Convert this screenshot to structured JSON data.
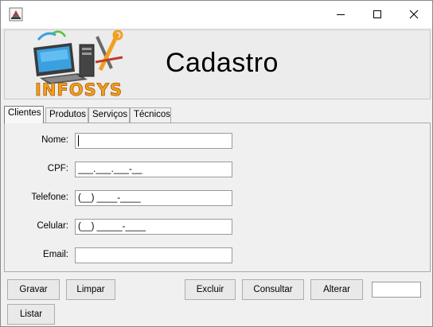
{
  "window": {
    "title": "",
    "icon": "java-app-icon",
    "controls": {
      "minimize_icon": "minimize-icon",
      "maximize_icon": "maximize-icon",
      "close_icon": "close-icon"
    }
  },
  "header": {
    "logo_text": "INFOSYS",
    "title": "Cadastro"
  },
  "tabs": [
    {
      "label": "Clientes",
      "active": true
    },
    {
      "label": "Produtos",
      "active": false
    },
    {
      "label": "Serviços",
      "active": false
    },
    {
      "label": "Técnicos",
      "active": false
    }
  ],
  "form": {
    "nome": {
      "label": "Nome:",
      "value": ""
    },
    "cpf": {
      "label": "CPF:",
      "value": "___.___.___-__"
    },
    "telefone": {
      "label": "Telefone:",
      "value": "(__) ____-____"
    },
    "celular": {
      "label": "Celular:",
      "value": "(__) _____-____"
    },
    "email": {
      "label": "Email:",
      "value": ""
    }
  },
  "buttons": {
    "gravar": "Gravar",
    "limpar": "Limpar",
    "excluir": "Excluir",
    "consultar": "Consultar",
    "alterar": "Alterar",
    "listar": "Listar"
  },
  "id_field": {
    "value": ""
  },
  "colors": {
    "window_bg": "#f0f0f0",
    "logo_orange": "#f0a020",
    "logo_blue": "#3aa0e0"
  }
}
